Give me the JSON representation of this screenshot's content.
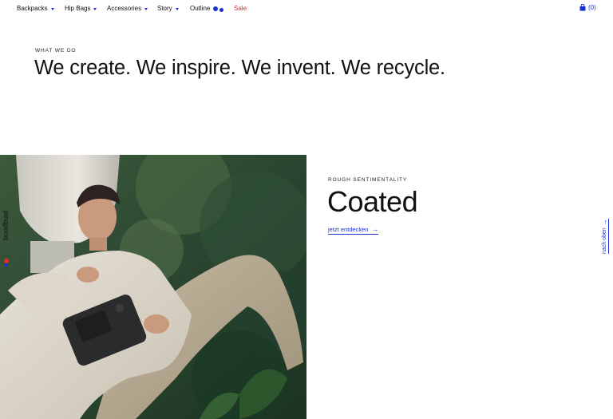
{
  "nav": {
    "items": [
      {
        "label": "Backpacks"
      },
      {
        "label": "Hip Bags"
      },
      {
        "label": "Accessories"
      },
      {
        "label": "Story"
      },
      {
        "label": "Outline"
      },
      {
        "label": "Sale"
      }
    ],
    "cart_count": "(0)"
  },
  "hero": {
    "eyebrow": "WHAT WE DO",
    "headline": "We create. We inspire. We invent. We recycle."
  },
  "photo": {
    "brand_watermark": "pinqponq"
  },
  "product": {
    "kicker": "ROUGH SENTIMENTALITY",
    "title": "Coated",
    "cta_label": "jetzt entdecken",
    "cta_arrow": "→"
  },
  "back_to_top": {
    "label": "nach oben",
    "arrow": "→"
  },
  "colors": {
    "accent": "#1b2fcc",
    "sale": "#e62b2b",
    "text": "#111111",
    "background": "#ffffff"
  }
}
